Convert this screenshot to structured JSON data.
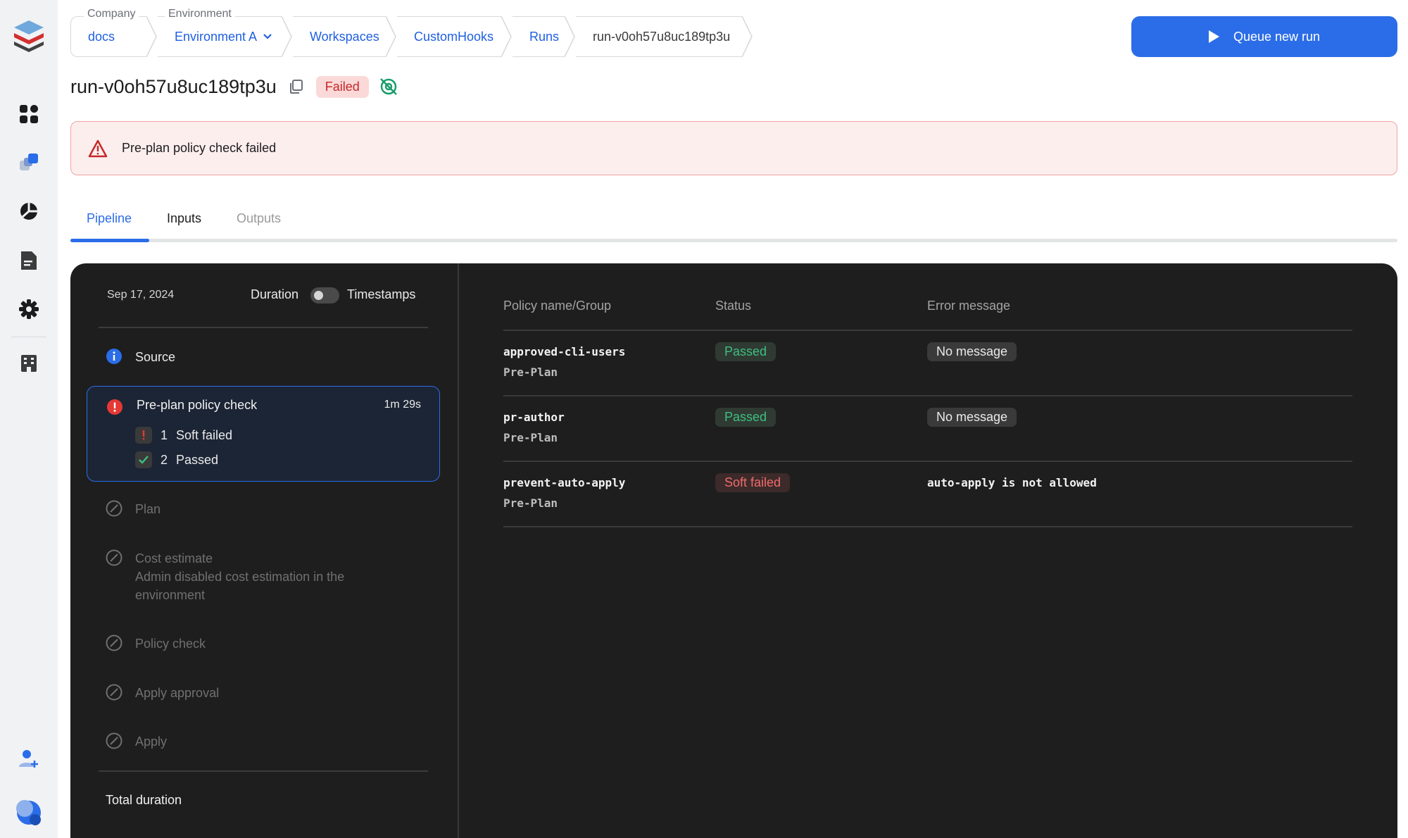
{
  "breadcrumb": {
    "company_label": "Company",
    "company_value": "docs",
    "environment_label": "Environment",
    "environment_value": "Environment A",
    "workspaces": "Workspaces",
    "workspace": "CustomHooks",
    "runs": "Runs",
    "current": "run-v0oh57u8uc189tp3u"
  },
  "actions": {
    "queue_label": "Queue new run"
  },
  "run": {
    "title": "run-v0oh57u8uc189tp3u",
    "status": "Failed"
  },
  "alert": {
    "message": "Pre-plan policy check failed"
  },
  "tabs": [
    {
      "label": "Pipeline",
      "active": true
    },
    {
      "label": "Inputs",
      "active": false
    },
    {
      "label": "Outputs",
      "active": false
    }
  ],
  "pipeline": {
    "date": "Sep 17, 2024",
    "duration_label": "Duration",
    "timestamps_label": "Timestamps",
    "steps": {
      "source": "Source",
      "preplan": "Pre-plan policy check",
      "preplan_duration": "1m 29s",
      "plan": "Plan",
      "cost": "Cost estimate",
      "cost_note": "Admin disabled cost estimation in the environment",
      "policy": "Policy check",
      "apply_approval": "Apply approval",
      "apply": "Apply"
    },
    "preplan_results": [
      {
        "count": "1",
        "label": "Soft failed"
      },
      {
        "count": "2",
        "label": "Passed"
      }
    ],
    "total_label": "Total duration"
  },
  "policy_table": {
    "headers": {
      "name": "Policy name/Group",
      "status": "Status",
      "error": "Error message"
    },
    "rows": [
      {
        "name": "approved-cli-users",
        "group": "Pre-Plan",
        "status": "Passed",
        "error": "No message"
      },
      {
        "name": "pr-author",
        "group": "Pre-Plan",
        "status": "Passed",
        "error": "No message"
      },
      {
        "name": "prevent-auto-apply",
        "group": "Pre-Plan",
        "status": "Soft failed",
        "error": "auto-apply is not allowed"
      }
    ]
  },
  "colors": {
    "accent": "#2b6de8",
    "danger": "#c62828",
    "success": "#3fbf7f",
    "panel": "#1e1e1e"
  }
}
